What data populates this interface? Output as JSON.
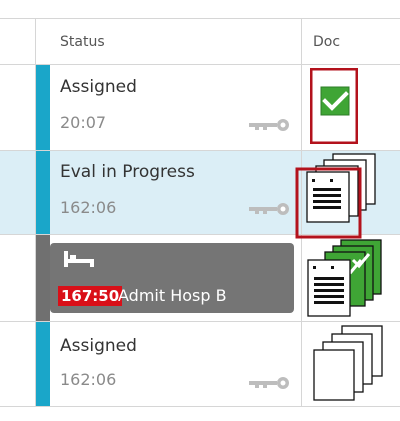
{
  "header": {
    "status_label": "Status",
    "doc_label": "Doc"
  },
  "rows": [
    {
      "status": "Assigned",
      "time": "20:07",
      "bar_color": "#1aa6c9",
      "doc_icon": "check-document-icon",
      "selected": false
    },
    {
      "status": "Eval in Progress",
      "time": "162:06",
      "bar_color": "#1aa6c9",
      "doc_icon": "document-stack-icon",
      "selected": true
    },
    {
      "status": "",
      "time_badge": "167:50",
      "admit_text": "Admit Hosp B",
      "bar_color": "#707070",
      "doc_icon": "document-stack-icon",
      "selected": false
    },
    {
      "status": "Assigned",
      "time": "162:06",
      "bar_color": "#1aa6c9",
      "doc_icon": "empty-document-stack-icon",
      "selected": false
    }
  ],
  "colors": {
    "accent_teal": "#1aa6c9",
    "highlight_red": "#b3121c",
    "badge_red": "#d90f18",
    "check_green": "#3fa535",
    "selected_row": "#dbeef6"
  }
}
